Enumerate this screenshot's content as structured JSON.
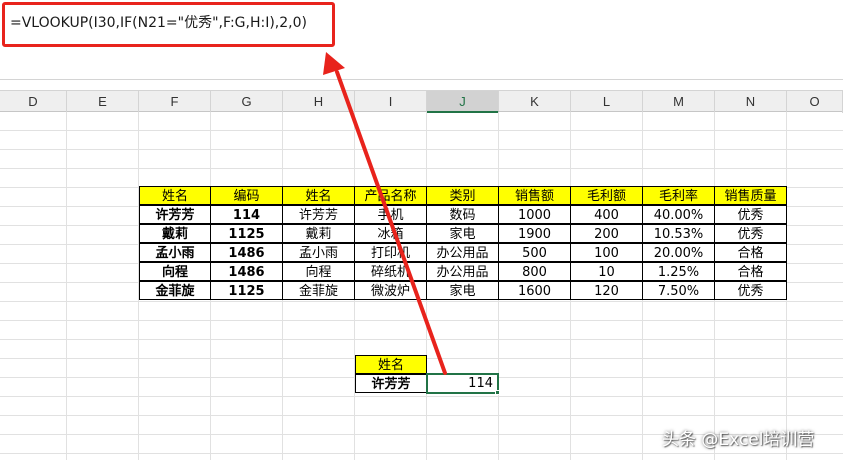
{
  "formula": "=VLOOKUP(I30,IF(N21=\"优秀\",F:G,H:I),2,0)",
  "columns": [
    "D",
    "E",
    "F",
    "G",
    "H",
    "I",
    "J",
    "K",
    "L",
    "M",
    "N",
    "O"
  ],
  "selected_column": "J",
  "table": {
    "headers": [
      "姓名",
      "编码",
      "姓名",
      "产品名称",
      "类别",
      "销售额",
      "毛利额",
      "毛利率",
      "销售质量"
    ],
    "rows": [
      [
        "许芳芳",
        "114",
        "许芳芳",
        "手机",
        "数码",
        "1000",
        "400",
        "40.00%",
        "优秀"
      ],
      [
        "戴莉",
        "1125",
        "戴莉",
        "冰箱",
        "家电",
        "1900",
        "200",
        "10.53%",
        "优秀"
      ],
      [
        "孟小雨",
        "1486",
        "孟小雨",
        "打印机",
        "办公用品",
        "500",
        "100",
        "20.00%",
        "合格"
      ],
      [
        "向程",
        "1486",
        "向程",
        "碎纸机",
        "办公用品",
        "800",
        "10",
        "1.25%",
        "合格"
      ],
      [
        "金菲旋",
        "1125",
        "金菲旋",
        "微波炉",
        "家电",
        "1600",
        "120",
        "7.50%",
        "优秀"
      ]
    ]
  },
  "lookup": {
    "header": "姓名",
    "name": "许芳芳",
    "result": "114"
  },
  "colors": {
    "highlight_border": "#e8231c",
    "header_fill": "#ffff00",
    "selection": "#217346"
  },
  "watermark": "头条 @Excel培训营"
}
